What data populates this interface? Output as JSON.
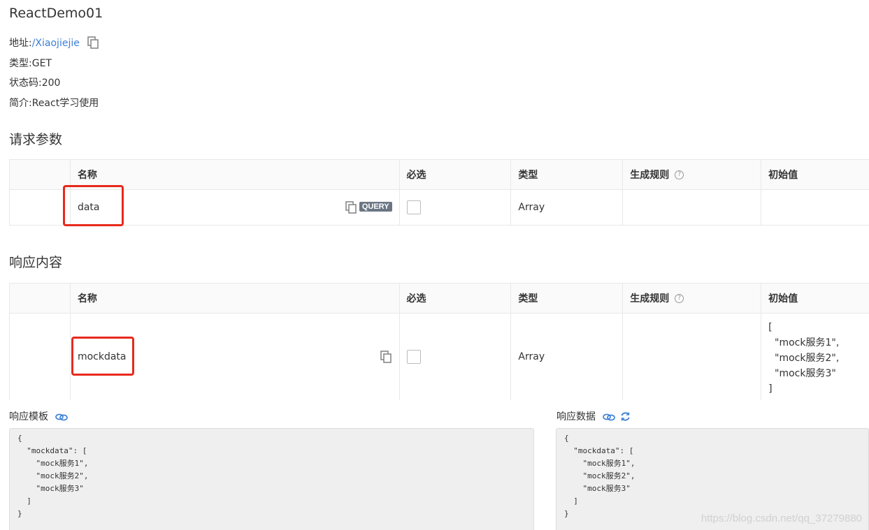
{
  "title": "ReactDemo01",
  "meta": {
    "address_label": "地址:",
    "address_value": "/Xiaojiejie",
    "type_label": "类型:",
    "type_value": "GET",
    "status_label": "状态码:",
    "status_value": "200",
    "desc_label": "简介:",
    "desc_value": "React学习使用"
  },
  "request": {
    "section_title": "请求参数",
    "headers": [
      "名称",
      "必选",
      "类型",
      "生成规则",
      "初始值"
    ],
    "rows": [
      {
        "name": "data",
        "badge": "QUERY",
        "type": "Array",
        "rule": "",
        "initial": ""
      }
    ]
  },
  "response": {
    "section_title": "响应内容",
    "headers": [
      "名称",
      "必选",
      "类型",
      "生成规则",
      "初始值"
    ],
    "rows": [
      {
        "name": "mockdata",
        "type": "Array",
        "rule": "",
        "initial": "[\n  \"mock服务1\",\n  \"mock服务2\",\n  \"mock服务3\"\n]"
      }
    ]
  },
  "template_label": "响应模板",
  "data_label": "响应数据",
  "template_code": "{\n  \"mockdata\": [\n    \"mock服务1\",\n    \"mock服务2\",\n    \"mock服务3\"\n  ]\n}",
  "data_code": "{\n  \"mockdata\": [\n    \"mock服务1\",\n    \"mock服务2\",\n    \"mock服务3\"\n  ]\n}",
  "watermark": "https://blog.csdn.net/qq_37279880",
  "colors": {
    "link": "#3b7fd6",
    "highlight": "#e8291c",
    "badge": "#6b7684"
  }
}
